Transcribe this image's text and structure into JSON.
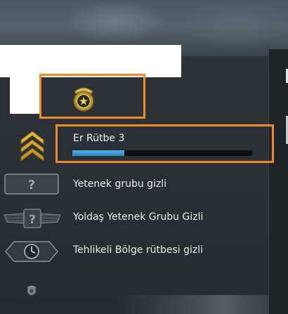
{
  "rank": {
    "title": "Er Rütbe 3",
    "progress": 0.29
  },
  "rows": [
    {
      "label": "Yetenek grubu gizli",
      "icon": "question-box-icon"
    },
    {
      "label": "Yoldaş Yetenek Grubu Gizli",
      "icon": "winged-question-icon"
    },
    {
      "label": "Tehlikeli Bölge rütbesi gizli",
      "icon": "danger-zone-clock-icon"
    }
  ],
  "colors": {
    "highlight": "#f28a2c",
    "xp_fill": "#3a9ad8",
    "rank_gold": "#d9b23a"
  },
  "icons": {
    "medal": "service-medal-icon",
    "rank": "gold-chevrons-icon",
    "footer": "small-emblem-icon"
  }
}
